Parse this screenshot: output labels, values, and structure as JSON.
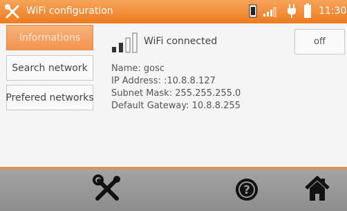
{
  "statusbar": {
    "title": "WiFi configuration",
    "time": "11:30",
    "icons": [
      "tools-icon",
      "sd-card-icon",
      "signal-icon",
      "plug-icon",
      "battery-icon"
    ],
    "accent_color": "#ee7b1f"
  },
  "sidebar": {
    "items": [
      {
        "label": "Informations",
        "active": true
      },
      {
        "label": "Search network",
        "active": false
      },
      {
        "label": "Prefered networks",
        "active": false
      }
    ]
  },
  "wifi": {
    "status": "WiFi connected",
    "toggle_label": "off",
    "name": "Name: gosc",
    "ip": "IP Address: :10.8.8.127",
    "subnet": "Subnet Mask: 255.255.255.0",
    "gateway": "Default Gateway: 10.8.8.255",
    "signal_level_bars": 2,
    "signal_total_bars": 4
  },
  "toolbar": {
    "icons": [
      "tools-icon",
      "help-icon",
      "home-icon"
    ]
  }
}
